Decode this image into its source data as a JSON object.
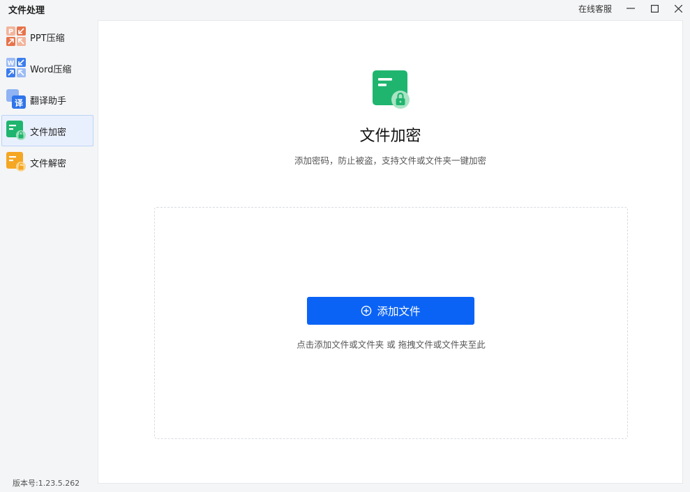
{
  "app": {
    "title": "文件处理"
  },
  "window": {
    "service_label": "在线客服"
  },
  "sidebar": {
    "items": [
      {
        "label": "PPT压缩",
        "icon": "ppt-compress-icon"
      },
      {
        "label": "Word压缩",
        "icon": "word-compress-icon"
      },
      {
        "label": "翻译助手",
        "icon": "translate-icon",
        "badge": "译"
      },
      {
        "label": "文件加密",
        "icon": "file-encrypt-icon",
        "active": true
      },
      {
        "label": "文件解密",
        "icon": "file-decrypt-icon"
      }
    ]
  },
  "version": "版本号:1.23.5.262",
  "main": {
    "title": "文件加密",
    "subtitle": "添加密码，防止被盗，支持文件或文件夹一键加密",
    "add_button_label": "添加文件",
    "drop_hint": "点击添加文件或文件夹 或 拖拽文件或文件夹至此"
  },
  "colors": {
    "accent": "#0b63f6",
    "encrypt_green": "#1fb56f",
    "ppt_orange": "#e8734a",
    "word_blue": "#3b7ded",
    "decrypt_orange": "#f5a623"
  }
}
